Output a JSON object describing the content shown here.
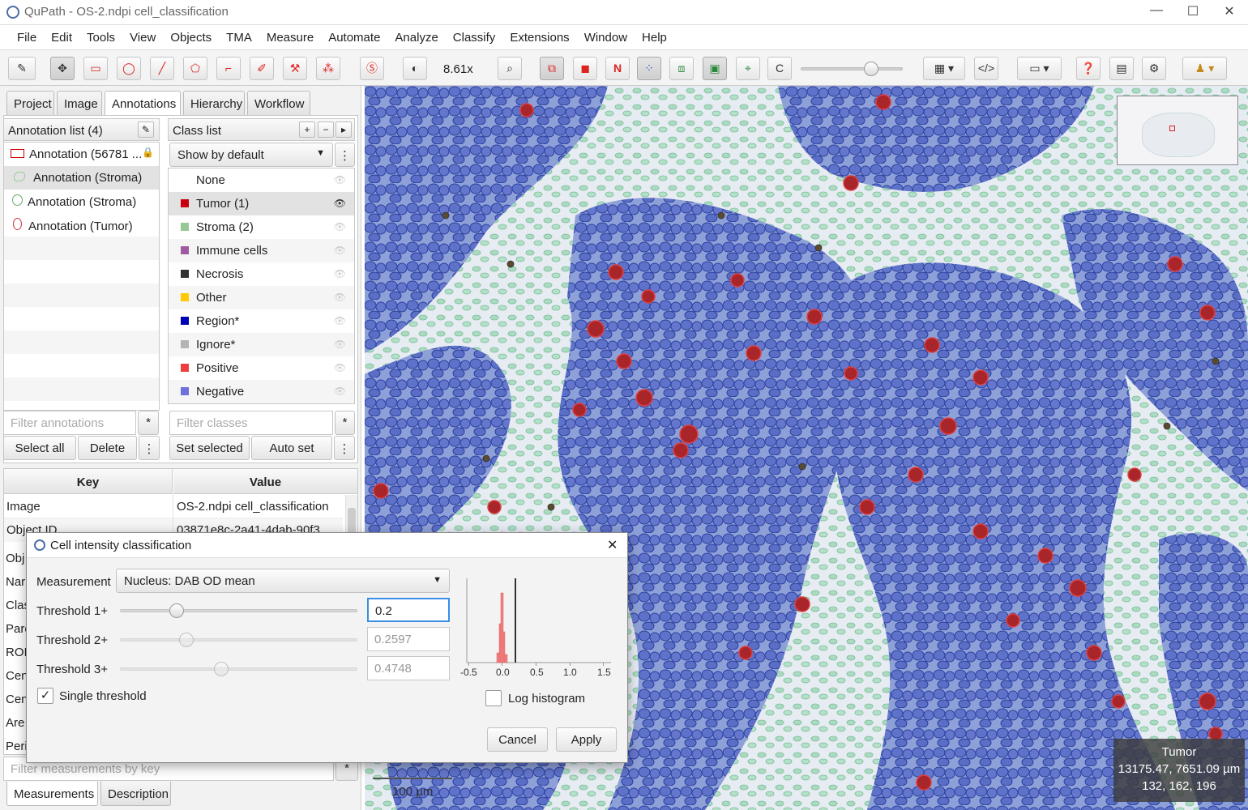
{
  "window": {
    "title": "QuPath - OS-2.ndpi cell_classification",
    "minimize": "—",
    "maximize": "☐",
    "close": "✕"
  },
  "menu": [
    "File",
    "Edit",
    "Tools",
    "View",
    "Objects",
    "TMA",
    "Measure",
    "Automate",
    "Analyze",
    "Classify",
    "Extensions",
    "Window",
    "Help"
  ],
  "toolbar": {
    "zoom": "8.61x",
    "n_label": "N",
    "c_label": "C"
  },
  "tabs": [
    "Project",
    "Image",
    "Annotations",
    "Hierarchy",
    "Workflow"
  ],
  "annotations": {
    "header": "Annotation list (4)",
    "items": [
      "Annotation (56781 ...",
      "Annotation (Stroma)",
      "Annotation (Stroma)",
      "Annotation (Tumor)"
    ],
    "filter_placeholder": "Filter annotations",
    "star": "*",
    "select_all": "Select all",
    "delete": "Delete",
    "more": "⋮"
  },
  "classes": {
    "header": "Class list",
    "show": "Show by default",
    "items": [
      {
        "name": "None",
        "color": "#ffffff"
      },
      {
        "name": "Tumor (1)",
        "color": "#c8000f"
      },
      {
        "name": "Stroma (2)",
        "color": "#96c896"
      },
      {
        "name": "Immune cells",
        "color": "#a05aa0"
      },
      {
        "name": "Necrosis",
        "color": "#323232"
      },
      {
        "name": "Other",
        "color": "#ffc800"
      },
      {
        "name": "Region*",
        "color": "#0000b4"
      },
      {
        "name": "Ignore*",
        "color": "#b4b4b4"
      },
      {
        "name": "Positive",
        "color": "#ee3e3e"
      },
      {
        "name": "Negative",
        "color": "#7070dd"
      }
    ],
    "filter_placeholder": "Filter classes",
    "star": "*",
    "set_selected": "Set selected",
    "auto_set": "Auto set",
    "more": "⋮"
  },
  "measurements": {
    "key_header": "Key",
    "value_header": "Value",
    "rows": [
      {
        "key": "Image",
        "value": "OS-2.ndpi cell_classification"
      },
      {
        "key": "Object ID",
        "value": "03871e8c-2a41-4dab-90f3..."
      }
    ],
    "partial_keys": [
      "Obj",
      "Nar",
      "Clas",
      "Pare",
      "ROI",
      "Cen",
      "Cen",
      "Are",
      "Peri"
    ],
    "filter_placeholder": "Filter measurements by key",
    "star": "*",
    "bottom_tabs": [
      "Measurements",
      "Description"
    ]
  },
  "viewer": {
    "scalebar": "100 µm",
    "info": {
      "class": "Tumor",
      "coords": "13175.47, 7651.09 µm",
      "rgb": "132, 162, 196"
    }
  },
  "dialog": {
    "title": "Cell intensity classification",
    "measurement_label": "Measurement",
    "measurement_value": "Nucleus: DAB OD mean",
    "t1_label": "Threshold 1+",
    "t1_value": "0.2",
    "t2_label": "Threshold 2+",
    "t2_value": "0.2597",
    "t3_label": "Threshold 3+",
    "t3_value": "0.4748",
    "single_threshold": "Single threshold",
    "single_checked": "✓",
    "log_histogram": "Log histogram",
    "cancel": "Cancel",
    "apply": "Apply",
    "close": "✕",
    "histogram_ticks": [
      "-0.5",
      "0.0",
      "0.5",
      "1.0",
      "1.5"
    ]
  }
}
